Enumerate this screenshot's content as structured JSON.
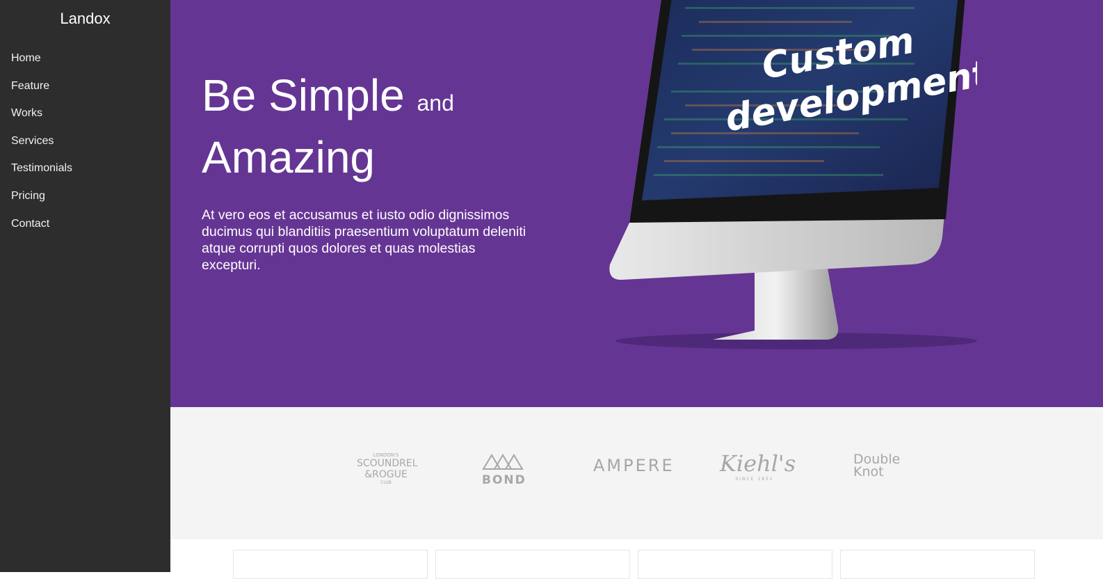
{
  "brand": "Landox",
  "nav": [
    "Home",
    "Feature",
    "Works",
    "Services",
    "Testimonials",
    "Pricing",
    "Contact"
  ],
  "hero": {
    "title_main_1": "Be Simple",
    "title_small": "and",
    "title_main_2": "Amazing",
    "text": "At vero eos et accusamus et iusto odio dignissimos ducimus qui blanditiis praesentium voluptatum deleniti atque corrupti quos dolores et quas molestias excepturi.",
    "screen_text_1": "Custom",
    "screen_text_2": "development"
  },
  "logos": {
    "scoundrel_top": "LONDON'S",
    "scoundrel_mid": "SCOUNDREL",
    "scoundrel_bottom": "&ROGUE",
    "scoundrel_club": "CLUB",
    "bond": "BOND",
    "ampere": "AMPERE",
    "kiehls": "Kiehl's",
    "kiehls_since": "SINCE 1851",
    "double_knot_1": "Double",
    "double_knot_2": "Knot"
  },
  "colors": {
    "sidebar": "#2d2d2d",
    "hero": "#653594",
    "logos_bg": "#f4f4f4"
  }
}
